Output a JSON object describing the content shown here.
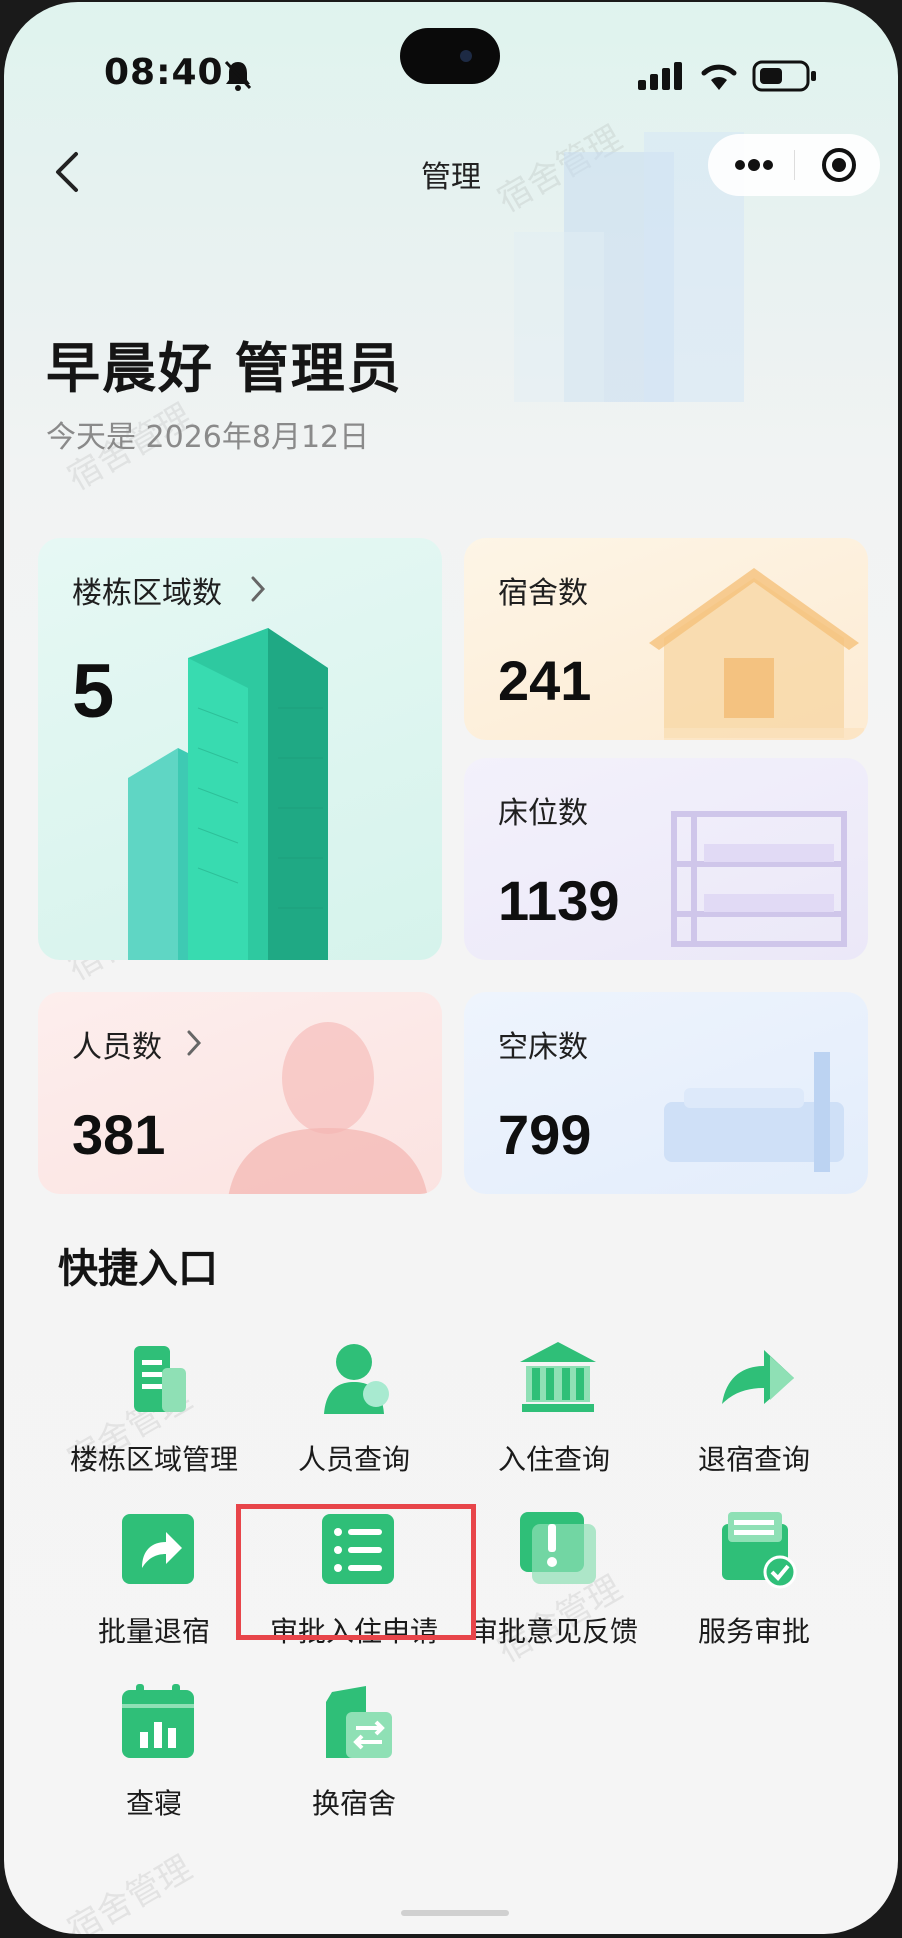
{
  "status_bar": {
    "time": "08:40"
  },
  "nav": {
    "title": "管理"
  },
  "greeting": {
    "title": "早晨好 管理员",
    "date": "今天是 2026年8月12日"
  },
  "stats": {
    "buildings": {
      "label": "楼栋区域数",
      "value": "5"
    },
    "dorms": {
      "label": "宿舍数",
      "value": "241"
    },
    "beds": {
      "label": "床位数",
      "value": "1139"
    },
    "people": {
      "label": "人员数",
      "value": "381"
    },
    "empty_beds": {
      "label": "空床数",
      "value": "799"
    }
  },
  "quick": {
    "title": "快捷入口",
    "items": [
      {
        "label": "楼栋区域管理",
        "icon": "building-icon"
      },
      {
        "label": "人员查询",
        "icon": "person-search-icon"
      },
      {
        "label": "入住查询",
        "icon": "bank-icon"
      },
      {
        "label": "退宿查询",
        "icon": "forward-arrow-icon"
      },
      {
        "label": "批量退宿",
        "icon": "share-arrow-icon"
      },
      {
        "label": "审批入住申请",
        "icon": "list-icon"
      },
      {
        "label": "审批意见反馈",
        "icon": "alert-icon"
      },
      {
        "label": "服务审批",
        "icon": "doc-check-icon"
      },
      {
        "label": "查寝",
        "icon": "calendar-chart-icon"
      },
      {
        "label": "换宿舍",
        "icon": "swap-icon"
      }
    ]
  },
  "watermark": "宿舍管理",
  "colors": {
    "accent": "#22b573",
    "highlight": "#e8454a"
  }
}
